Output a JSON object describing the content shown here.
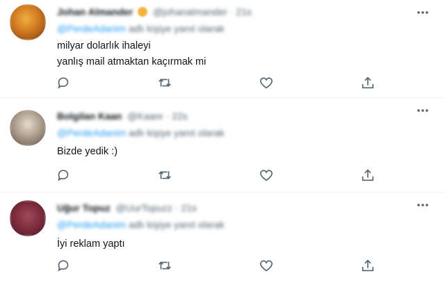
{
  "tweets": [
    {
      "name": "Johan Almander",
      "handle": "@johanalmander · 21s",
      "reply_to": "@PerdeAdanim",
      "reply_suffix": "adlı kişiye yanıt olarak",
      "text": "milyar dolarlık ihaleyi\nyanlış mail atmaktan kaçırmak mi",
      "avatar_color": "#c4721c"
    },
    {
      "name": "Bolgilan Kaan",
      "handle": "@Kaanr · 22s",
      "reply_to": "@PerdeAdanim",
      "reply_suffix": "adlı kişiye yanıt olarak",
      "text": "Bizde yedik :)",
      "avatar_color": "#8a7b6e"
    },
    {
      "name": "Uğur Topuz",
      "handle": "@UurTopuzz · 21s",
      "reply_to": "@PerdeAdanim",
      "reply_suffix": "adlı kişiye yanıt olarak",
      "text": "İyi reklam yaptı",
      "avatar_color": "#7a2b3c"
    }
  ],
  "colors": {
    "icon": "#536471",
    "link": "#1d9bf0",
    "divider": "#eff3f4"
  },
  "icons": [
    "more-icon",
    "reply-icon",
    "retweet-icon",
    "like-icon",
    "share-icon"
  ]
}
